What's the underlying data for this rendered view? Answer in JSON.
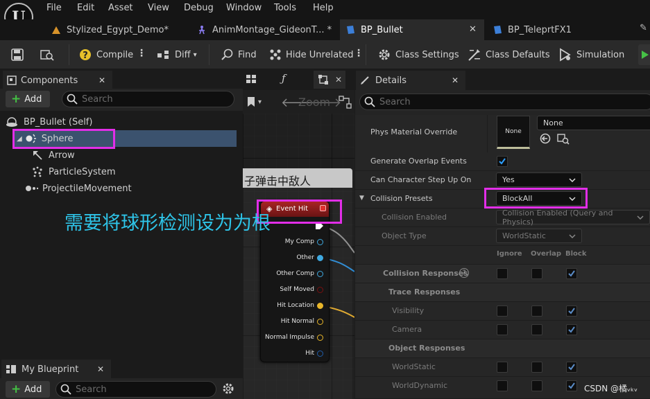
{
  "menubar": {
    "items": [
      "File",
      "Edit",
      "Asset",
      "View",
      "Debug",
      "Window",
      "Tools",
      "Help"
    ]
  },
  "tabs": [
    {
      "label": "Stylized_Egypt_Demo*",
      "icon": "level-icon",
      "active": false
    },
    {
      "label": "AnimMontage_GideonT... *",
      "icon": "anim-montage-icon",
      "active": false
    },
    {
      "label": "BP_Bullet",
      "icon": "blueprint-icon",
      "active": true
    },
    {
      "label": "BP_TeleprtFX1",
      "icon": "blueprint-icon",
      "active": false
    }
  ],
  "toolbar": {
    "compile": "Compile",
    "diff": "Diff",
    "find": "Find",
    "hide_unrelated": "Hide Unrelated",
    "class_settings": "Class Settings",
    "class_defaults": "Class Defaults",
    "simulation": "Simulation"
  },
  "components": {
    "title": "Components",
    "add_label": "Add",
    "search_placeholder": "Search",
    "root": "BP_Bullet (Self)",
    "items": [
      {
        "label": "Sphere",
        "selected": true
      },
      {
        "label": "Arrow",
        "selected": false
      },
      {
        "label": "ParticleSystem",
        "selected": false
      },
      {
        "label": "ProjectileMovement",
        "selected": false
      }
    ]
  },
  "my_blueprint": {
    "title": "My Blueprint",
    "add_label": "Add",
    "search_placeholder": "Search"
  },
  "graph": {
    "comment_title": "子弹击中敌人",
    "zoom_label": "Zoom",
    "event_node": {
      "title": "Event Hit",
      "pins": [
        "My Comp",
        "Other",
        "Other Comp",
        "Self Moved",
        "Hit Location",
        "Hit Normal",
        "Normal Impulse",
        "Hit"
      ]
    }
  },
  "annotation": {
    "text": "需要将球形检测设为为根",
    "color": "#2ec4e8"
  },
  "details": {
    "title": "Details",
    "search_placeholder": "Search",
    "phys_material_label": "Phys Material Override",
    "phys_material_thumb": "None",
    "phys_material_value": "None",
    "generate_overlap_label": "Generate Overlap Events",
    "generate_overlap_checked": true,
    "step_up_label": "Can Character Step Up On",
    "step_up_value": "Yes",
    "collision_presets_label": "Collision Presets",
    "collision_presets_value": "BlockAll",
    "collision_enabled_label": "Collision Enabled",
    "collision_enabled_value": "Collision Enabled (Query and Physics)",
    "object_type_label": "Object Type",
    "object_type_value": "WorldStatic",
    "col_headers": [
      "Ignore",
      "Overlap",
      "Block"
    ],
    "collision_responses_label": "Collision Responses",
    "trace_responses_label": "Trace Responses",
    "trace_rows": [
      "Visibility",
      "Camera"
    ],
    "object_responses_label": "Object Responses",
    "object_rows": [
      "WorldStatic",
      "WorldDynamic"
    ]
  },
  "watermark": "CSDN @橘ᵥₖᵥ",
  "colors": {
    "highlight": "#e22ee8",
    "accent": "#2da0ff",
    "node_header": "#8e1e1e",
    "selected_row": "#3b526e"
  }
}
